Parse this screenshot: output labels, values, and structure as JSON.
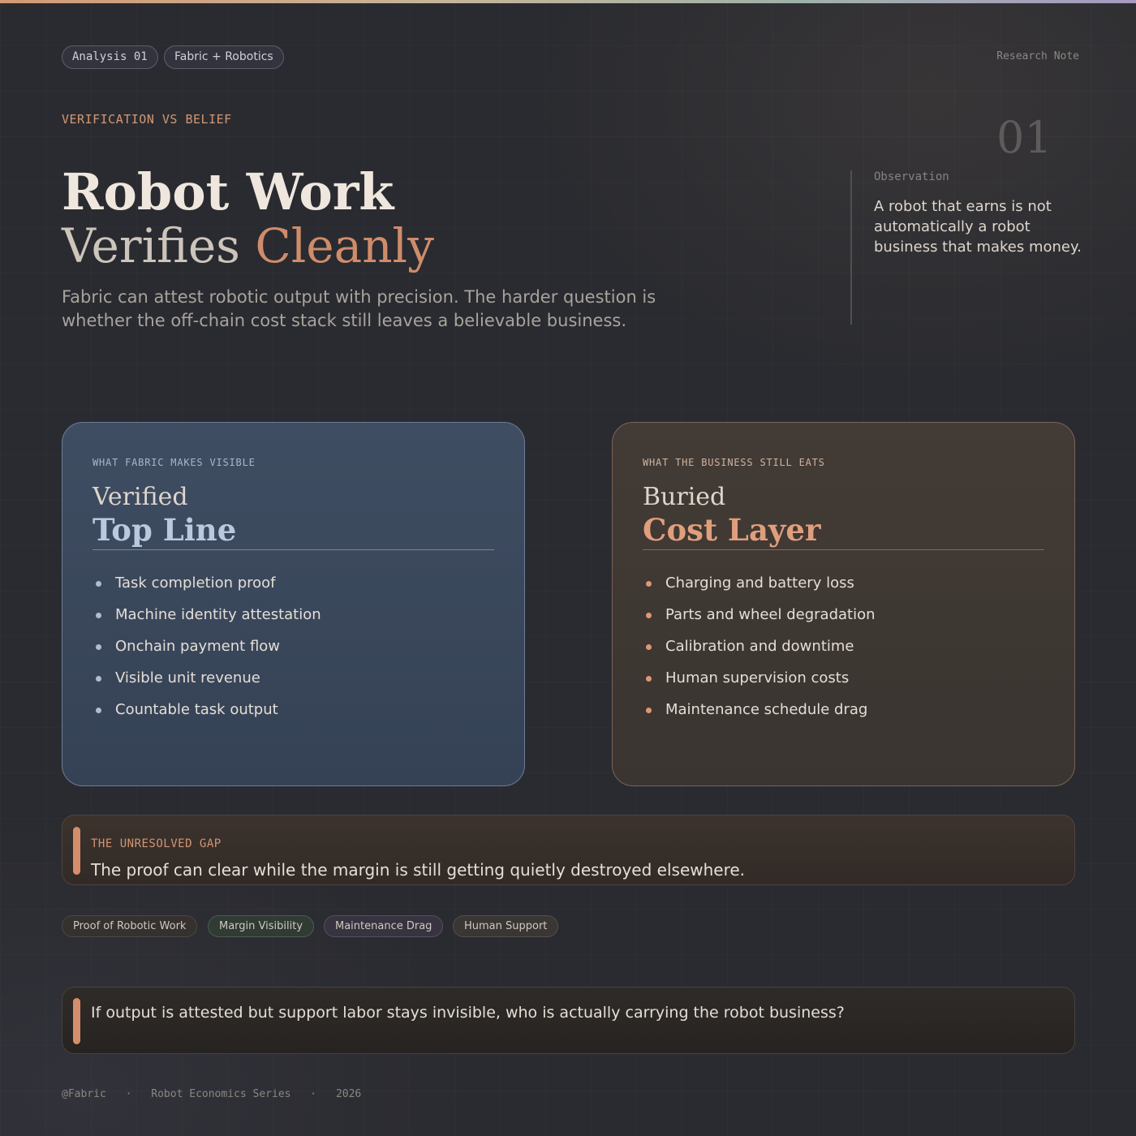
{
  "header": {
    "pills": [
      "Analysis 01",
      "Fabric + Robotics"
    ],
    "research_note": "Research Note",
    "eyebrow": "VERIFICATION VS BELIEF",
    "number": "01"
  },
  "hero": {
    "title_line1": "Robot Work",
    "title_line2_plain": "Verifies",
    "title_line2_accent": "Cleanly",
    "subtitle": "Fabric can attest robotic output with precision. The harder question is whether the off-chain cost stack still leaves a believable business."
  },
  "observation": {
    "label": "Observation",
    "text": "A robot that earns is not automatically a robot business that makes money."
  },
  "cards": {
    "left": {
      "eyebrow": "WHAT FABRIC MAKES VISIBLE",
      "heading_light": "Verified",
      "heading_bold": "Top Line",
      "items": [
        "Task completion proof",
        "Machine identity attestation",
        "Onchain payment flow",
        "Visible unit revenue",
        "Countable task output"
      ]
    },
    "right": {
      "eyebrow": "WHAT THE BUSINESS STILL EATS",
      "heading_light": "Buried",
      "heading_bold": "Cost Layer",
      "items": [
        "Charging and battery loss",
        "Parts and wheel degradation",
        "Calibration and downtime",
        "Human supervision costs",
        "Maintenance schedule drag"
      ]
    }
  },
  "gap": {
    "label": "THE UNRESOLVED GAP",
    "text": "The proof can clear while the margin is still getting quietly destroyed elsewhere."
  },
  "tags": [
    "Proof of Robotic Work",
    "Margin Visibility",
    "Maintenance Drag",
    "Human Support"
  ],
  "question": "If output is attested but support labor stays invisible, who is actually carrying the robot business?",
  "footer": {
    "handle": "@Fabric",
    "series": "Robot Economics Series",
    "year": "2026",
    "separator": "·"
  },
  "colors": {
    "accent": "#cf8c6b",
    "left_card_accent": "#b9c9de",
    "right_card_accent": "#e09e7d"
  }
}
